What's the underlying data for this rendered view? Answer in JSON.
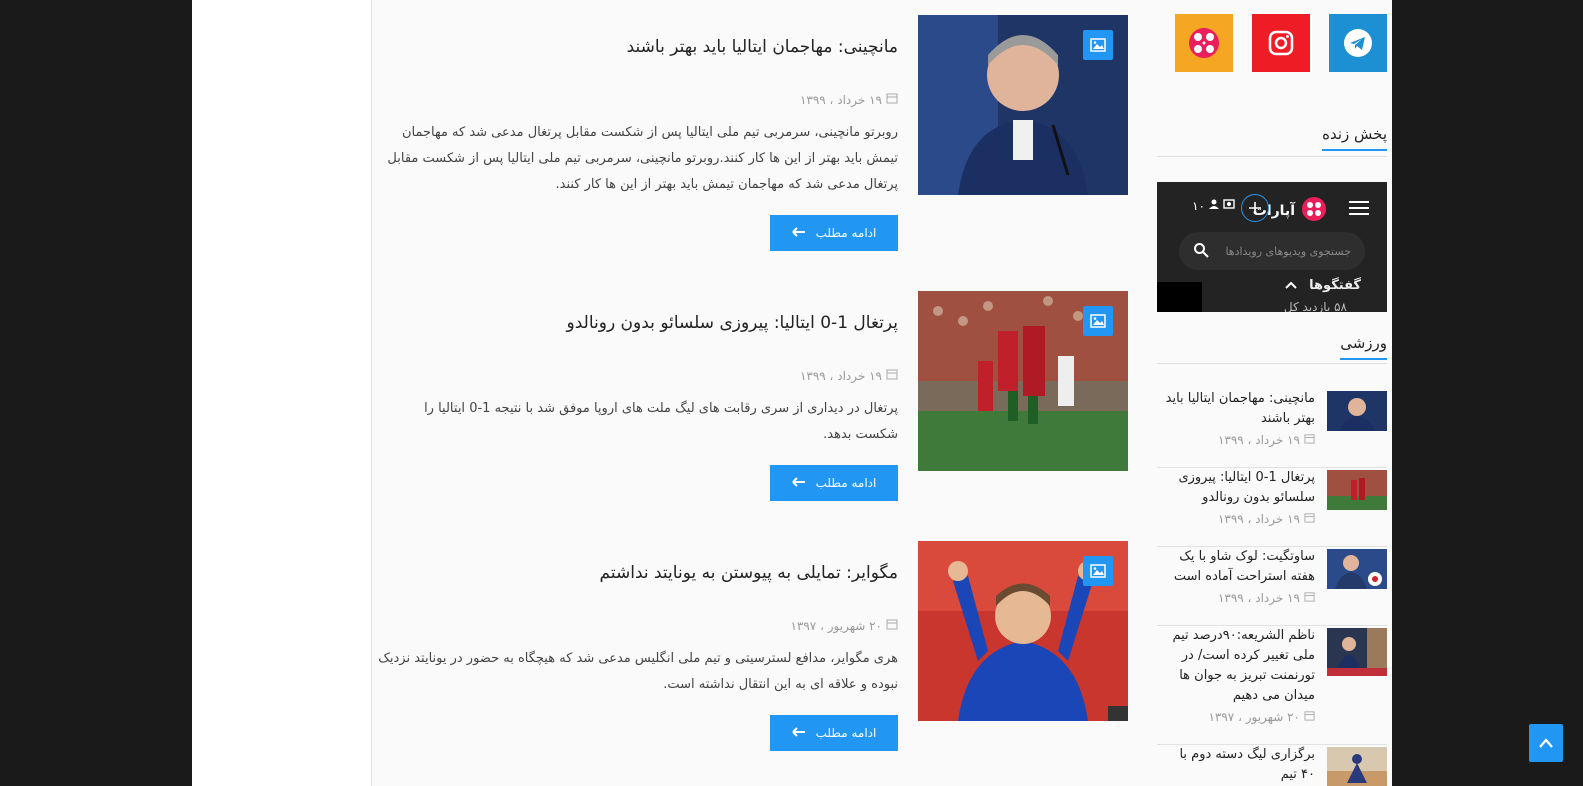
{
  "posts": [
    {
      "title": "مانچینی: مهاجمان ایتالیا باید بهتر باشند",
      "date": "۱۹ خرداد ، ۱۳۹۹",
      "excerpt": "روبرتو مانچینی، سرمربی تیم ملی ایتالیا پس از شکست مقابل پرتغال مدعی شد که مهاجمان تیمش باید بهتر از این ها کار کنند.روبرتو مانچینی، سرمربی تیم ملی ایتالیا پس از شکست مقابل پرتغال مدعی شد که مهاجمان تیمش باید بهتر از این ها کار کنند.",
      "more": "ادامه مطلب"
    },
    {
      "title": "پرتغال 1-0 ایتالیا: پیروزی سلسائو بدون رونالدو",
      "date": "۱۹ خرداد ، ۱۳۹۹",
      "excerpt": "پرتغال در دیداری از سری رقابت های لیگ ملت های اروپا موفق شد با نتیجه 1-0 ایتالیا را شکست بدهد.",
      "more": "ادامه مطلب"
    },
    {
      "title": "مگوایر: تمایلی به پیوستن به یونایتد نداشتم",
      "date": "۲۰ شهریور ، ۱۳۹۷",
      "excerpt": "هری مگوایر، مدافع لسترسیتی و تیم ملی انگلیس مدعی شد که هیچگاه به حضور در یونایتد نزدیک نبوده و علاقه ای به این انتقال نداشته است.",
      "more": "ادامه مطلب"
    }
  ],
  "sidebar": {
    "social": [
      "telegram-icon",
      "instagram-icon",
      "aparat-icon"
    ],
    "live_title": "پخش زنده",
    "live": {
      "brand": "آپارات",
      "search_placeholder": "جستجوی ویدیوهای رویدادها",
      "talks": "گفتگوها",
      "views": "۵۸ بازدید کل",
      "counter": "۱۰"
    },
    "sports_title": "ورزشی",
    "items": [
      {
        "title": "مانچینی: مهاجمان ایتالیا باید بهتر باشند",
        "date": "۱۹ خرداد ، ۱۳۹۹"
      },
      {
        "title": "پرتغال 1-0 ایتالیا: پیروزی سلسائو بدون رونالدو",
        "date": "۱۹ خرداد ، ۱۳۹۹"
      },
      {
        "title": "ساوتگیت: لوک شاو با یک هفته استراحت آماده است",
        "date": "۱۹ خرداد ، ۱۳۹۹"
      },
      {
        "title": "ناظم الشریعه:۹۰درصد تیم ملی تغییر کرده است/ در تورنمنت تبریز به جوان ها میدان می دهیم",
        "date": "۲۰ شهریور ، ۱۳۹۷"
      },
      {
        "title": "برگزاری لیگ دسته دوم با ۴۰ تیم",
        "date": ""
      }
    ]
  },
  "colors": {
    "accent": "#2196f3"
  }
}
